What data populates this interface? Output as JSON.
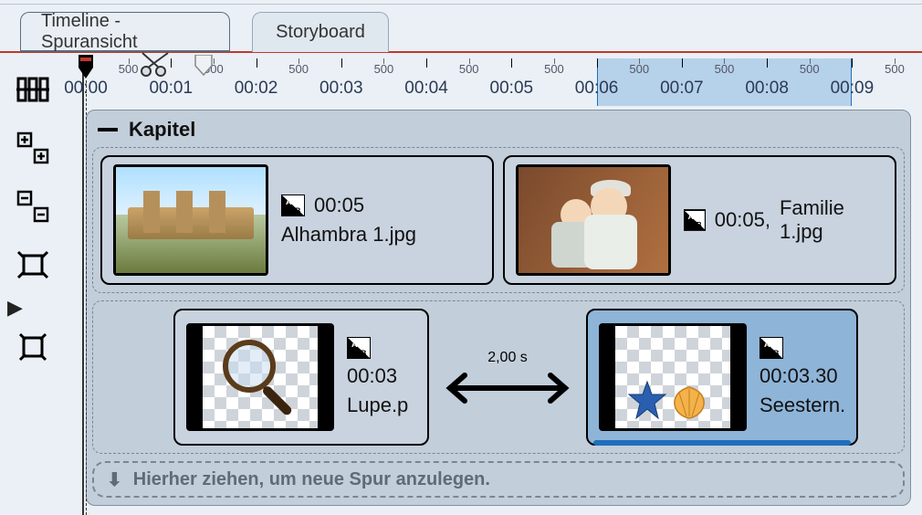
{
  "tabs": {
    "timeline": "Timeline - Spuransicht",
    "storyboard": "Storyboard"
  },
  "toolbar": {
    "split": "split-tracks",
    "zoom_in": "zoom-in",
    "zoom_out": "zoom-out",
    "fit": "fit-view",
    "fit_all": "fit-all"
  },
  "ruler": {
    "major": [
      "00:00",
      "00:01",
      "00:02",
      "00:03",
      "00:04",
      "00:05",
      "00:06",
      "00:07",
      "00:08",
      "00:09"
    ],
    "minor_label": "500",
    "selection_start": 6,
    "selection_end": 9
  },
  "chapter": {
    "title": "Kapitel"
  },
  "clips": {
    "track1": [
      {
        "duration": "00:05",
        "filename": "Alhambra 1.jpg",
        "thumb": "alhambra"
      },
      {
        "duration": "00:05,",
        "filename": "Familie 1.jpg",
        "thumb": "family"
      }
    ],
    "track2": [
      {
        "duration": "00:03",
        "filename": "Lupe.p",
        "thumb": "loupe",
        "selected": false
      },
      {
        "duration": "00:03.30",
        "filename": "Seestern.",
        "thumb": "seastar",
        "selected": true
      }
    ],
    "gap_label": "2,00 s"
  },
  "dropzone": {
    "text": "Hierher ziehen, um neue Spur anzulegen."
  }
}
